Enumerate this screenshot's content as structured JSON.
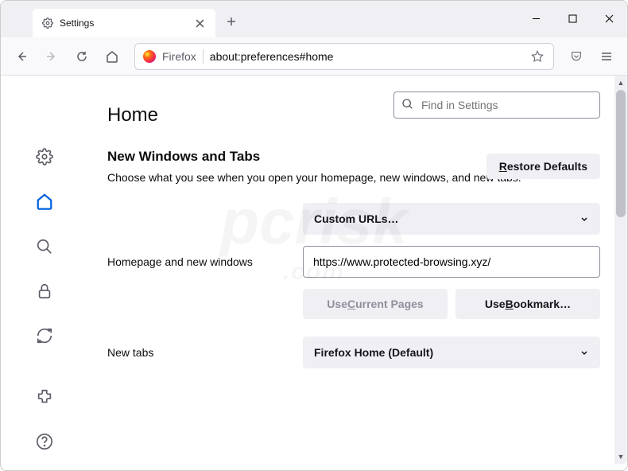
{
  "tab": {
    "title": "Settings"
  },
  "urlbar": {
    "prefix": "Firefox",
    "url": "about:preferences#home"
  },
  "search": {
    "placeholder": "Find in Settings"
  },
  "page": {
    "title": "Home"
  },
  "buttons": {
    "restore": "Restore Defaults",
    "useCurrent": "Use Current Pages",
    "useBookmark": "Use Bookmark…"
  },
  "section": {
    "title": "New Windows and Tabs",
    "desc": "Choose what you see when you open your homepage, new windows, and new tabs."
  },
  "rows": {
    "homepage": {
      "label": "Homepage and new windows",
      "select": "Custom URLs…",
      "value": "https://www.protected-browsing.xyz/"
    },
    "newtabs": {
      "label": "New tabs",
      "select": "Firefox Home (Default)"
    }
  }
}
